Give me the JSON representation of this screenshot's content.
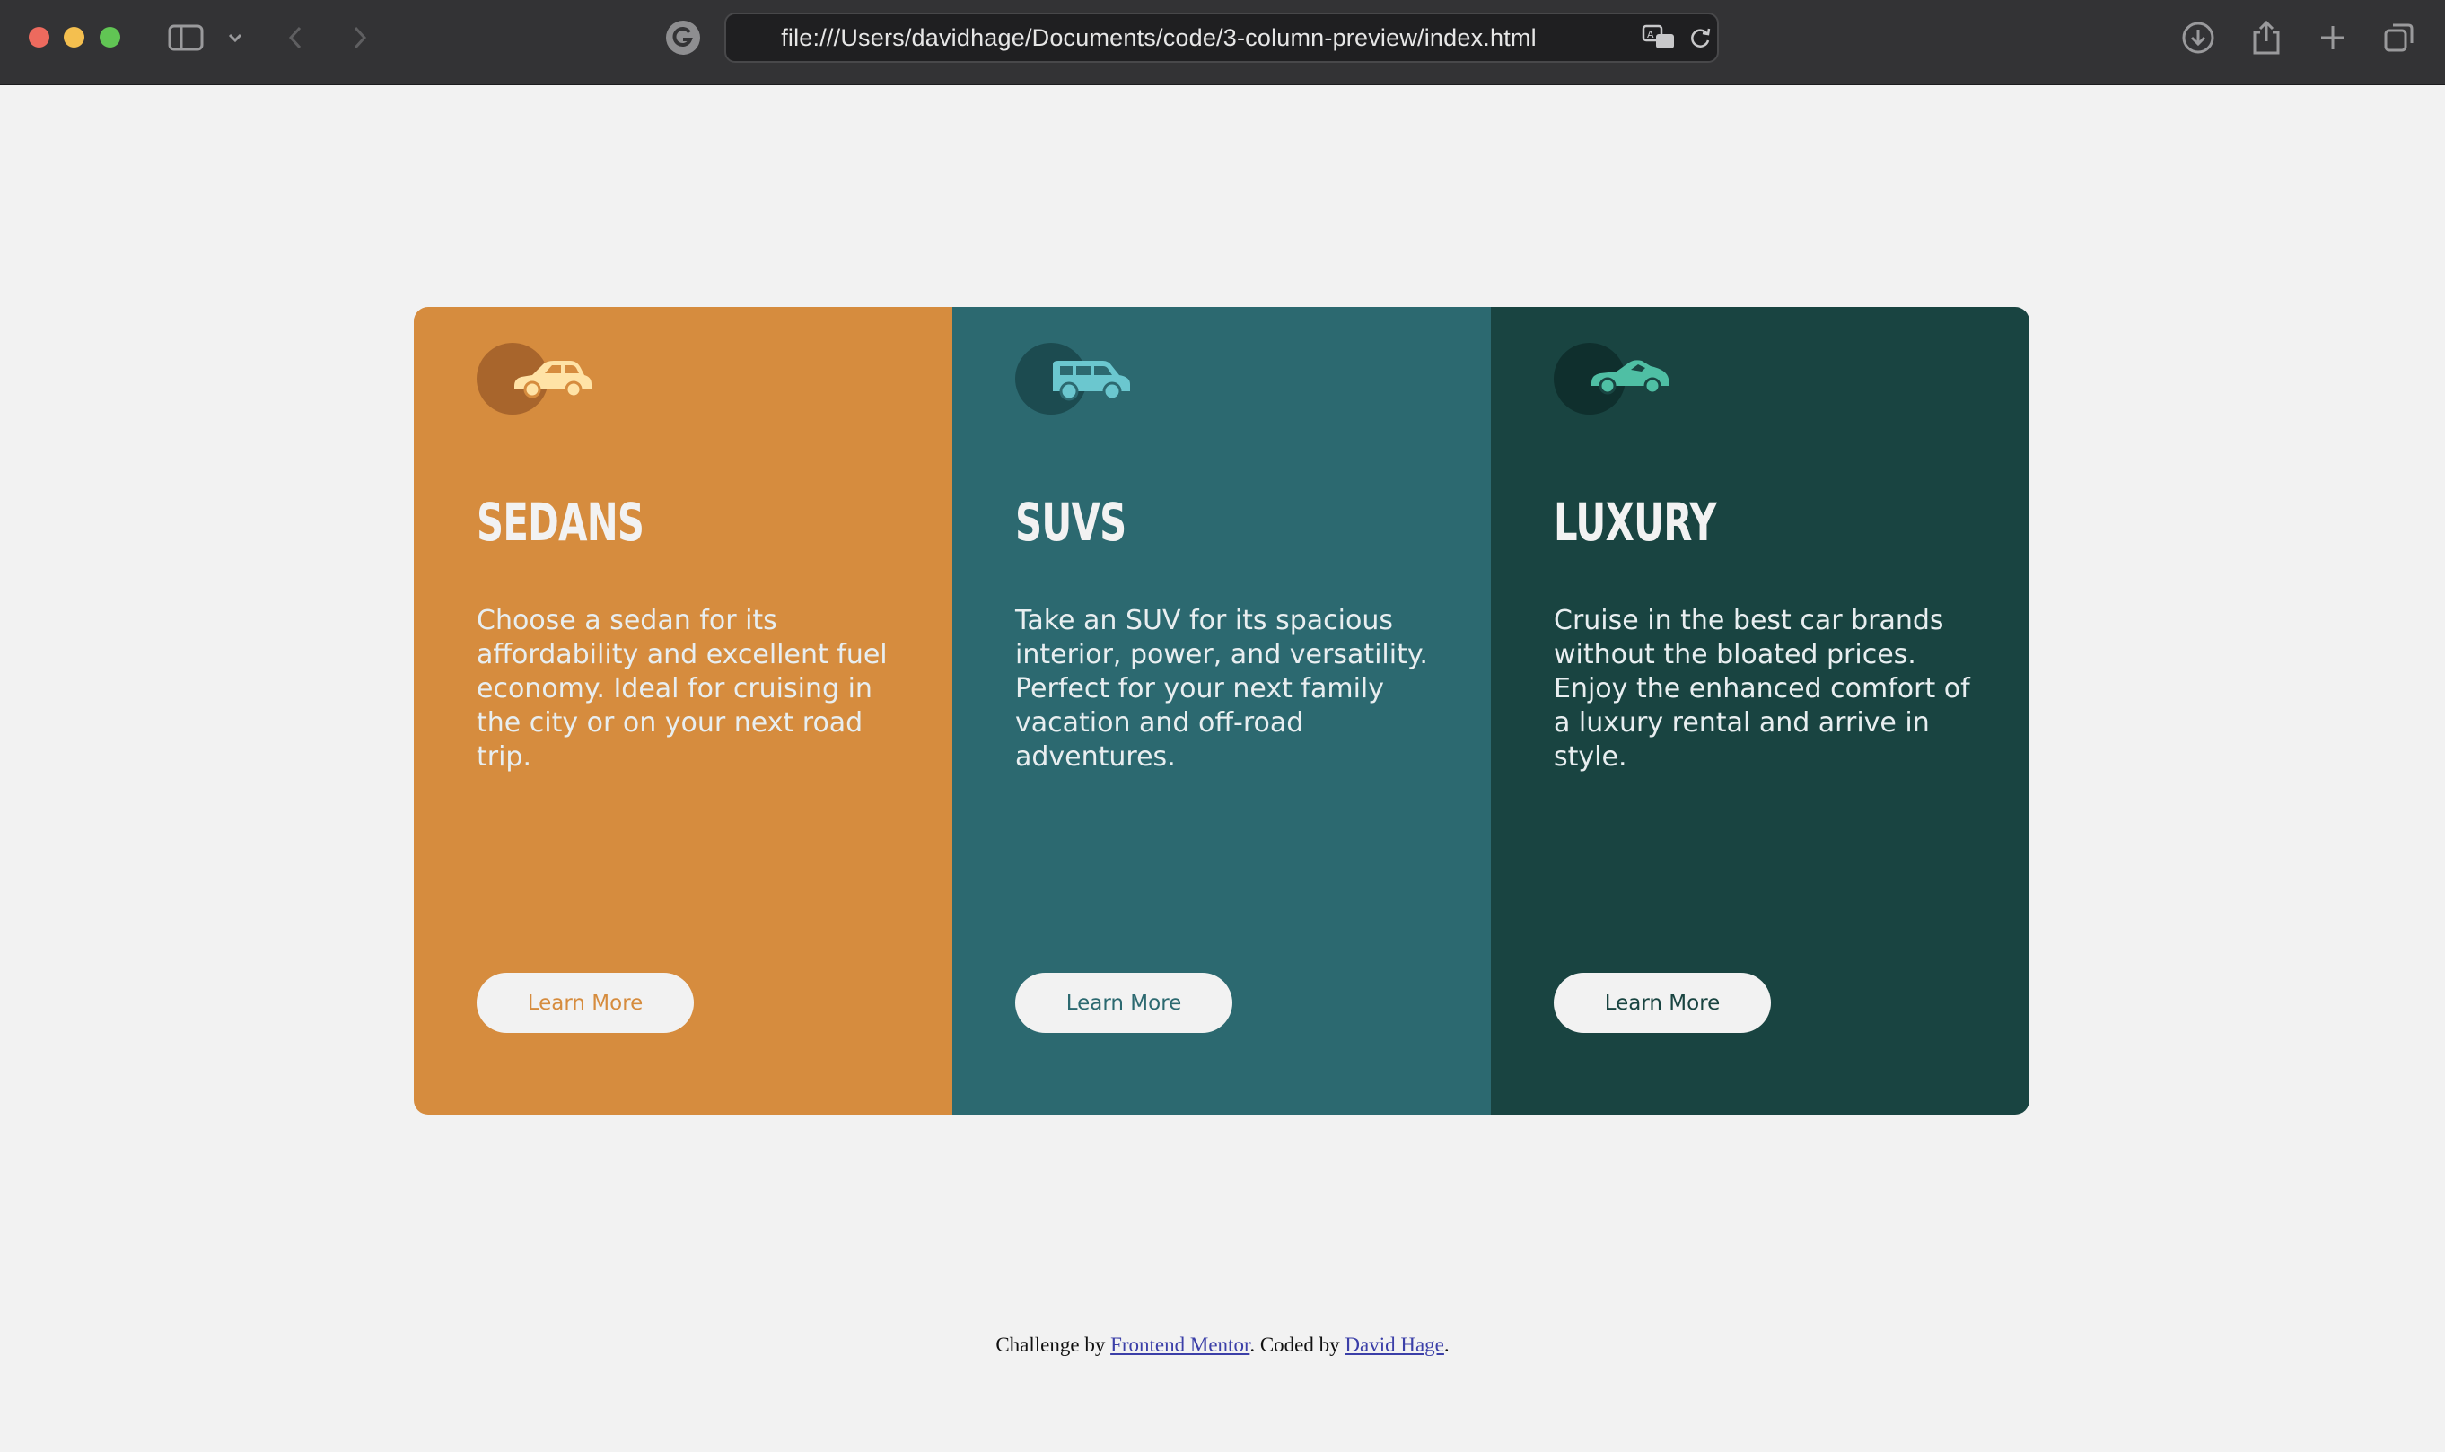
{
  "browser": {
    "url": "file:///Users/davidhage/Documents/code/3-column-preview/index.html"
  },
  "cards": [
    {
      "title": "SEDANS",
      "text": "Choose a sedan for its affordability and excellent fuel economy. Ideal for cruising in the city or on your next road trip.",
      "button": "Learn More",
      "icon": "sedan-car-icon",
      "color": "#d68c3e"
    },
    {
      "title": "SUVS",
      "text": "Take an SUV for its spacious interior, power, and versatility. Perfect for your next family vacation and off-road adventures.",
      "button": "Learn More",
      "icon": "suv-car-icon",
      "color": "#2c6970"
    },
    {
      "title": "LUXURY",
      "text": "Cruise in the best car brands without the bloated prices. Enjoy the enhanced comfort of a luxury rental and arrive in style.",
      "button": "Learn More",
      "icon": "luxury-car-icon",
      "color": "#194441"
    }
  ],
  "footer": {
    "prefix": "Challenge by ",
    "link1": "Frontend Mentor",
    "middle": ". Coded by ",
    "link2": "David Hage",
    "suffix": "."
  }
}
